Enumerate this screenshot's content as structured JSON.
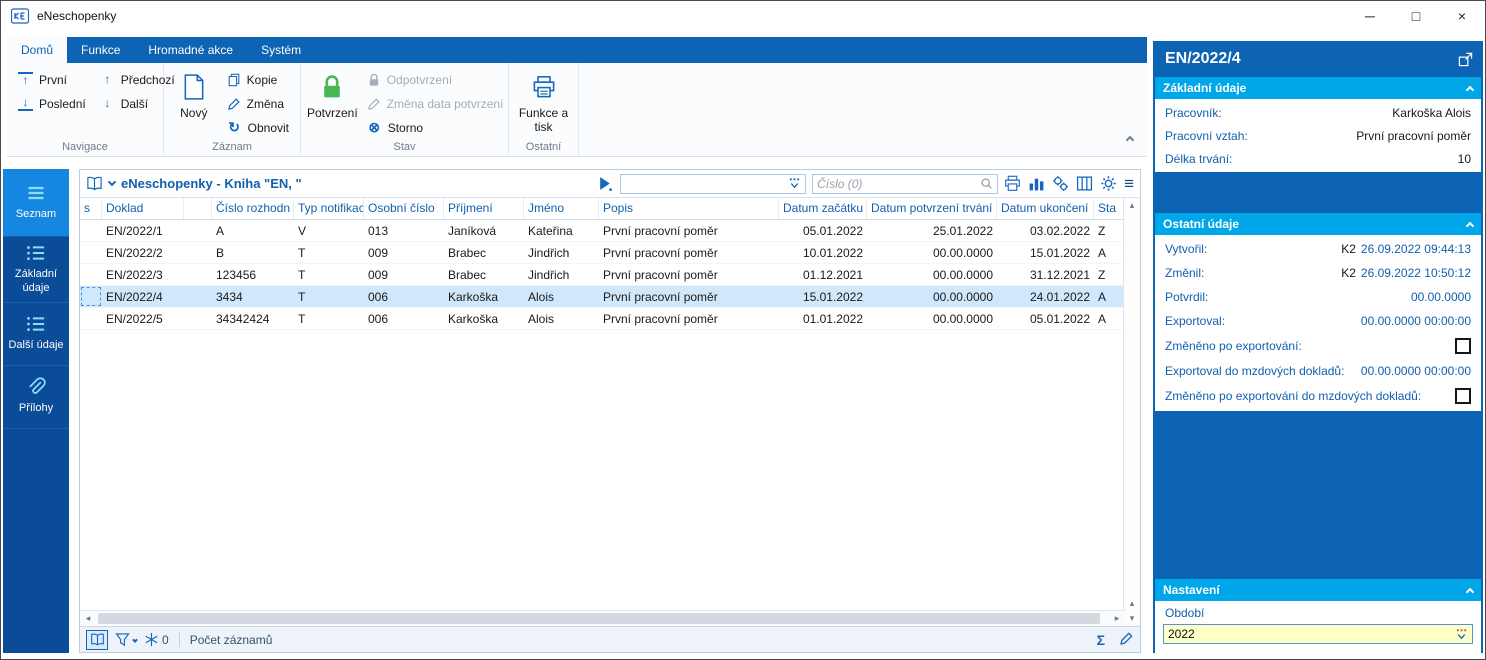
{
  "window": {
    "title": "eNeschopenky"
  },
  "icons": {
    "minimize": "─",
    "maximize": "□",
    "close": "×",
    "arrow_up": "↑",
    "arrow_down": "↓",
    "refresh": "↻",
    "storno": "⊗",
    "menu": "≡",
    "sigma": "Σ",
    "tri_up": "▴",
    "tri_down": "▾",
    "tri_left": "◂",
    "tri_right": "▸"
  },
  "ribbon": {
    "tabs": [
      {
        "label": "Domů",
        "active": true
      },
      {
        "label": "Funkce",
        "active": false
      },
      {
        "label": "Hromadné akce",
        "active": false
      },
      {
        "label": "Systém",
        "active": false
      }
    ],
    "navigace": {
      "label": "Navigace",
      "prvni": "První",
      "posledni": "Poslední",
      "predchozi": "Předchozí",
      "dalsi": "Další"
    },
    "zaznam": {
      "label": "Záznam",
      "novy": "Nový",
      "kopie": "Kopie",
      "zmena": "Změna",
      "obnovit": "Obnovit"
    },
    "stav": {
      "label": "Stav",
      "potvrzeni": "Potvrzení",
      "odpotvrzeni": "Odpotvrzení",
      "zmena_data": "Změna data potvrzení",
      "storno": "Storno"
    },
    "ostatni": {
      "label": "Ostatní",
      "funkce_tisk": "Funkce a tisk"
    }
  },
  "sidebar": {
    "items": [
      {
        "label": "Seznam",
        "active": true
      },
      {
        "label": "Základní údaje",
        "active": false
      },
      {
        "label": "Další údaje",
        "active": false
      },
      {
        "label": "Přílohy",
        "active": false
      }
    ]
  },
  "browse": {
    "title": "eNeschopenky - Kniha \"EN, \"",
    "filter_value": "",
    "search_placeholder": "Číslo (0)",
    "columns": [
      "s",
      "Doklad",
      "",
      "Číslo rozhodn",
      "Typ notifikace",
      "Osobní číslo",
      "Příjmení",
      "Jméno",
      "Popis",
      "Datum začátku",
      "Datum potvrzení trvání",
      "Datum ukončení",
      "Sta"
    ],
    "rows": [
      [
        "",
        "EN/2022/1",
        "",
        "A",
        "V",
        "013",
        "Janíková",
        "Kateřina",
        "První pracovní poměr",
        "05.01.2022",
        "25.01.2022",
        "03.02.2022",
        "Z"
      ],
      [
        "",
        "EN/2022/2",
        "",
        "B",
        "T",
        "009",
        "Brabec",
        "Jindřich",
        "První pracovní poměr",
        "10.01.2022",
        "00.00.0000",
        "15.01.2022",
        "A"
      ],
      [
        "",
        "EN/2022/3",
        "",
        "123456",
        "T",
        "009",
        "Brabec",
        "Jindřich",
        "První pracovní poměr",
        "01.12.2021",
        "00.00.0000",
        "31.12.2021",
        "Z"
      ],
      [
        "",
        "EN/2022/4",
        "",
        "3434",
        "T",
        "006",
        "Karkoška",
        "Alois",
        "První pracovní poměr",
        "15.01.2022",
        "00.00.0000",
        "24.01.2022",
        "A"
      ],
      [
        "",
        "EN/2022/5",
        "",
        "34342424",
        "T",
        "006",
        "Karkoška",
        "Alois",
        "První pracovní poměr",
        "01.01.2022",
        "00.00.0000",
        "05.01.2022",
        "A"
      ]
    ],
    "selected_index": 3,
    "status": {
      "frozen": "0",
      "records": "Počet záznamů"
    }
  },
  "detail": {
    "title": "EN/2022/4",
    "zakladni": {
      "header": "Základní údaje",
      "rows": [
        {
          "label": "Pracovník:",
          "value": "Karkoška Alois"
        },
        {
          "label": "Pracovní vztah:",
          "value": "První pracovní poměr"
        },
        {
          "label": "Délka trvání:",
          "value": "10"
        }
      ]
    },
    "ostatni": {
      "header": "Ostatní údaje",
      "vytvoril_label": "Vytvořil:",
      "vytvoril_user": "K2",
      "vytvoril_value": "26.09.2022 09:44:13",
      "zmenil_label": "Změnil:",
      "zmenil_user": "K2",
      "zmenil_value": "26.09.2022 10:50:12",
      "potvrdil_label": "Potvrdil:",
      "potvrdil_value": "00.00.0000",
      "exportoval_label": "Exportoval:",
      "exportoval_value": "00.00.0000 00:00:00",
      "zmeneno_label": "Změněno po exportování:",
      "zmeneno_checked": false,
      "exportoval_mzdy_label": "Exportoval do mzdových dokladů:",
      "exportoval_mzdy_value": "00.00.0000 00:00:00",
      "zmeneno_mzdy_label": "Změněno po exportování do mzdových dokladů:",
      "zmeneno_mzdy_checked": false
    },
    "nastaveni": {
      "header": "Nastavení",
      "obdobi_label": "Období",
      "obdobi_value": "2022"
    }
  }
}
